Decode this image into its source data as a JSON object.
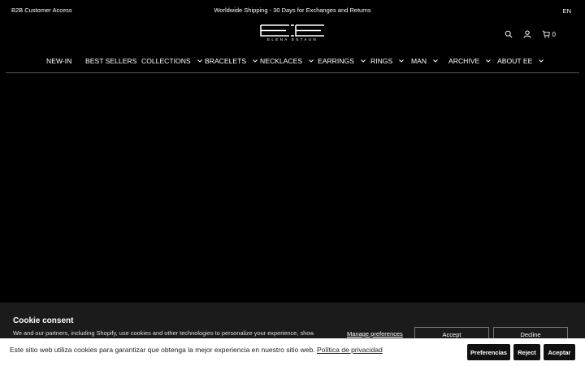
{
  "topbar": {
    "b2b_label": "B2B Customer Access",
    "promo_text": "Worldwide Shipping - 30 Days for Exchanges and Returns",
    "language": "EN"
  },
  "brand": {
    "name": "ELENA ESTAUN"
  },
  "header": {
    "cart_count": "0",
    "icons": [
      "search-icon",
      "account-icon",
      "cart-icon"
    ]
  },
  "nav": {
    "items": [
      {
        "label": "NEW-IN",
        "has_dropdown": false
      },
      {
        "label": "BEST SELLERS",
        "has_dropdown": false
      },
      {
        "label": "COLLECTIONS",
        "has_dropdown": true
      },
      {
        "label": "BRACELETS",
        "has_dropdown": true
      },
      {
        "label": "NECKLACES",
        "has_dropdown": true
      },
      {
        "label": "EARRINGS",
        "has_dropdown": true
      },
      {
        "label": "RINGS",
        "has_dropdown": true
      },
      {
        "label": "MAN",
        "has_dropdown": true
      },
      {
        "label": "ARCHIVE",
        "has_dropdown": true
      },
      {
        "label": "ABOUT EE",
        "has_dropdown": true
      }
    ]
  },
  "cookie_consent": {
    "title": "Cookie consent",
    "text": "We and our partners, including Shopify, use cookies and other technologies to personalize your experience, show",
    "manage_label": "Manage preferences",
    "accept_label": "Accept",
    "decline_label": "Decline"
  },
  "privacy_bar": {
    "text": "Este sitio web utiliza cookies para garantizar que obtenga la mejor experiencia en nuestro sitio web.",
    "link_text": "Política de privacidad",
    "preferences_label": "Preferencias",
    "reject_label": "Reject",
    "accept_label": "Aceptar"
  },
  "colors": {
    "background": "#000000",
    "text": "#ffffff",
    "consent_panel": "#1b1b1b",
    "privacy_bar": "#ffffff"
  }
}
